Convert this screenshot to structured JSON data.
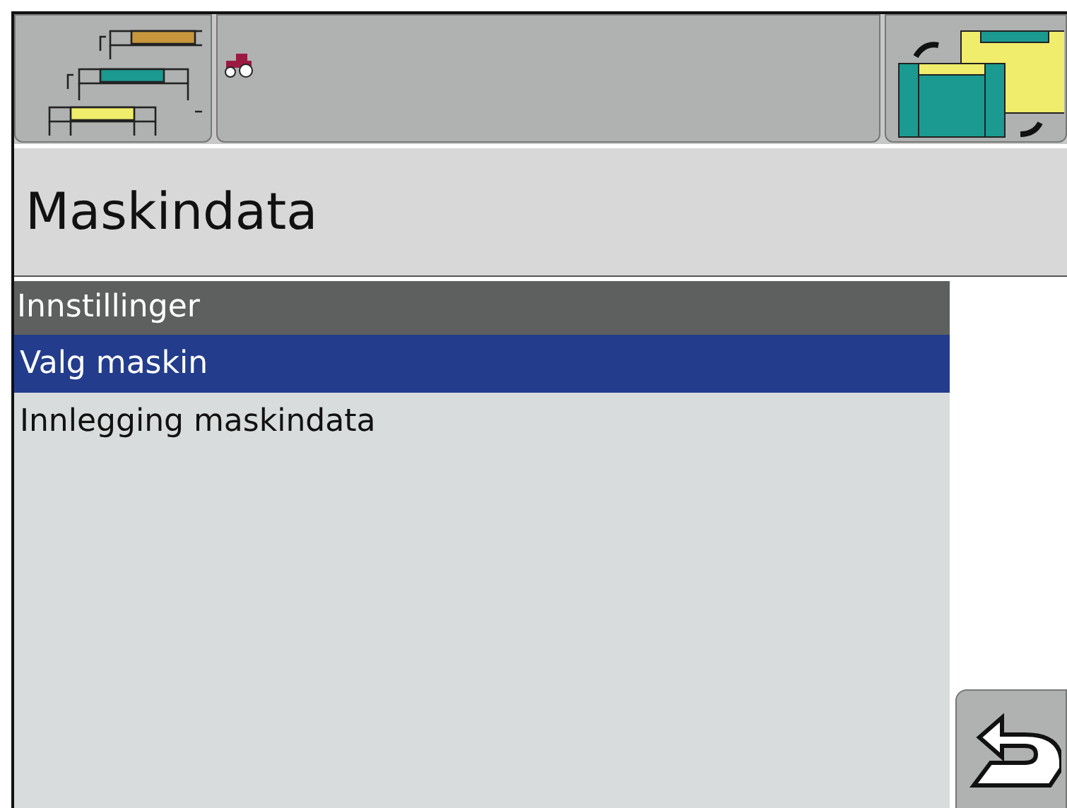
{
  "title": "Maskindata",
  "list": {
    "header": "Innstillinger",
    "items": [
      {
        "label": "Valg maskin",
        "selected": true
      },
      {
        "label": "Innlegging maskindata",
        "selected": false
      }
    ]
  }
}
